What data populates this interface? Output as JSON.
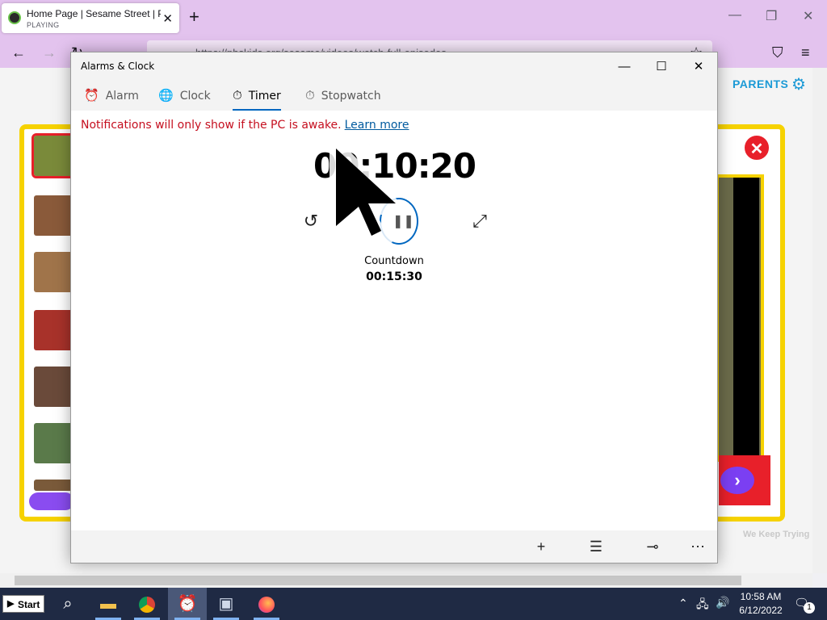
{
  "browser": {
    "tab_title": "Home Page | Sesame Street | PBS",
    "tab_status": "PLAYING",
    "url": "https://pbskids.org/sesame/videos/watch-full-episodes"
  },
  "site": {
    "parents_label": "PARENTS",
    "keep_trying": "We Keep Trying"
  },
  "app": {
    "title": "Alarms & Clock",
    "tabs": [
      {
        "label": "Alarm",
        "icon": "alarm-icon"
      },
      {
        "label": "Clock",
        "icon": "globe-clock-icon"
      },
      {
        "label": "Timer",
        "icon": "timer-icon"
      },
      {
        "label": "Stopwatch",
        "icon": "stopwatch-icon"
      }
    ],
    "active_tab": "Timer",
    "notice": "Notifications will only show if the PC is awake.",
    "learn_more": "Learn more",
    "timer": {
      "remaining": "00:10:20",
      "name": "Countdown",
      "duration": "00:15:30",
      "state": "running"
    }
  },
  "taskbar": {
    "start_label": "Start",
    "time": "10:58 AM",
    "date": "6/12/2022",
    "notification_count": "1",
    "apps": [
      "search",
      "file-explorer",
      "chrome",
      "alarms-clock",
      "photos",
      "firefox"
    ]
  },
  "colors": {
    "accent": "#0067c0",
    "notice": "#c50f1f",
    "browser_chrome": "#e3c3ee",
    "site_frame": "#f6d200",
    "site_red": "#e8202a",
    "taskbar": "#1f2a44"
  }
}
